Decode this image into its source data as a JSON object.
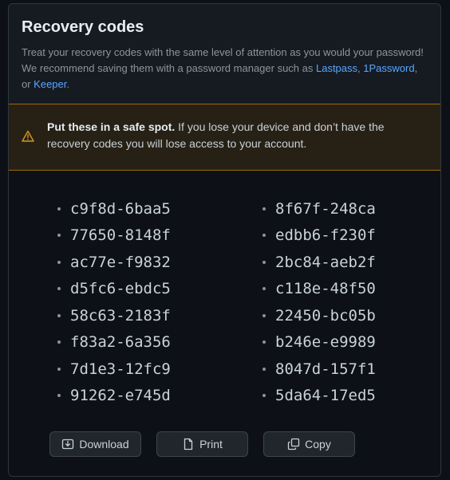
{
  "header": {
    "title": "Recovery codes",
    "desc_part1": "Treat your recovery codes with the same level of attention as you would your password! We recommend saving them with a password manager such as ",
    "link_lastpass": "Lastpass",
    "sep1": ", ",
    "link_1password": "1Password",
    "sep2": ", or ",
    "link_keeper": "Keeper",
    "desc_end": "."
  },
  "warning": {
    "icon": "alert-triangle-icon",
    "bold": "Put these in a safe spot.",
    "text": " If you lose your device and don’t have the recovery codes you will lose access to your account."
  },
  "codes": {
    "left": [
      "c9f8d-6baa5",
      "77650-8148f",
      "ac77e-f9832",
      "d5fc6-ebdc5",
      "58c63-2183f",
      "f83a2-6a356",
      "7d1e3-12fc9",
      "91262-e745d"
    ],
    "right": [
      "8f67f-248ca",
      "edbb6-f230f",
      "2bc84-aeb2f",
      "c118e-48f50",
      "22450-bc05b",
      "b246e-e9989",
      "8047d-157f1",
      "5da64-17ed5"
    ]
  },
  "buttons": {
    "download": "Download",
    "print": "Print",
    "copy": "Copy"
  },
  "colors": {
    "background": "#0d1117",
    "panel": "#161b22",
    "link": "#58a6ff",
    "warning_border": "#9e6a03",
    "warning_icon": "#d29922"
  }
}
